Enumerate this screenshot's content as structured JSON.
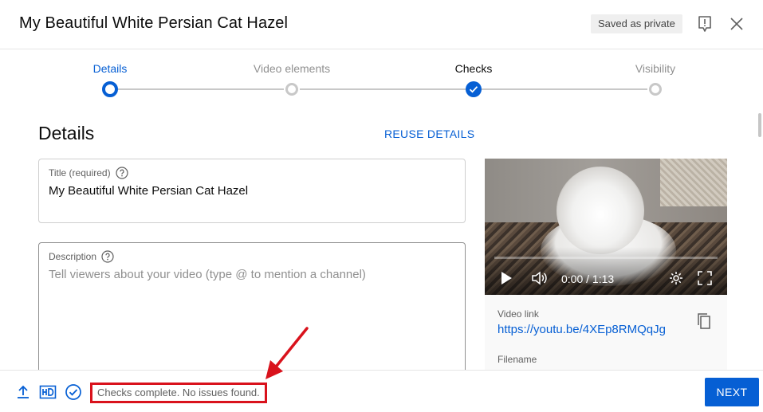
{
  "header": {
    "title": "My Beautiful White Persian Cat Hazel",
    "saved_badge": "Saved as private",
    "icons": {
      "feedback": "feedback-icon",
      "close": "close-icon"
    }
  },
  "stepper": {
    "steps": [
      {
        "label": "Details",
        "state": "active"
      },
      {
        "label": "Video elements",
        "state": "idle"
      },
      {
        "label": "Checks",
        "state": "complete"
      },
      {
        "label": "Visibility",
        "state": "idle"
      }
    ]
  },
  "details": {
    "heading": "Details",
    "reuse_label": "REUSE DETAILS",
    "title_field": {
      "label": "Title (required)",
      "value": "My Beautiful White Persian Cat Hazel"
    },
    "description_field": {
      "label": "Description",
      "placeholder": "Tell viewers about your video (type @ to mention a channel)"
    }
  },
  "preview": {
    "time": "0:00 / 1:13",
    "video_link_label": "Video link",
    "video_link": "https://youtu.be/4XEp8RMQqJg",
    "filename_label": "Filename"
  },
  "footer": {
    "status": "Checks complete. No issues found.",
    "next_label": "NEXT",
    "icons": [
      "upload-icon",
      "hd-icon",
      "checks-complete-icon"
    ]
  },
  "colors": {
    "accent": "#065fd4",
    "annotation_red": "#d9121c"
  }
}
